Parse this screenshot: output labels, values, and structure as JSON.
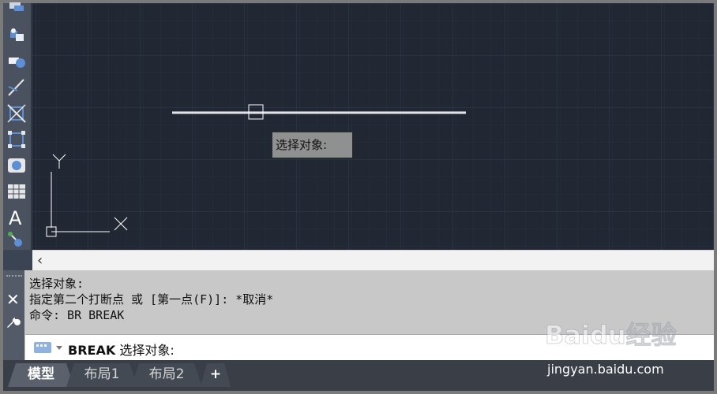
{
  "canvas": {
    "tooltip": "选择对象:",
    "ucs": {
      "y_label": "Y",
      "x_label": "X"
    }
  },
  "scroll": {
    "left_arrow": "‹"
  },
  "command": {
    "history": [
      "选择对象:",
      "指定第二个打断点 或 [第一点(F)]: *取消*",
      "命令: BR BREAK"
    ],
    "close_label": "✕",
    "prompt_command": "BREAK",
    "prompt_text": " 选择对象:"
  },
  "tabs": [
    {
      "label": "模型",
      "active": true
    },
    {
      "label": "布局1",
      "active": false
    },
    {
      "label": "布局2",
      "active": false
    },
    {
      "label": "+",
      "active": false
    }
  ],
  "watermark": {
    "brand": "Baidu经验",
    "url": "jingyan.baidu.com"
  },
  "colors": {
    "canvas": "#212834",
    "grid": "#2c3543",
    "toolbar": "#4a5260",
    "command_bg": "#c8c8c8",
    "tooltip_bg": "#8f9090"
  }
}
